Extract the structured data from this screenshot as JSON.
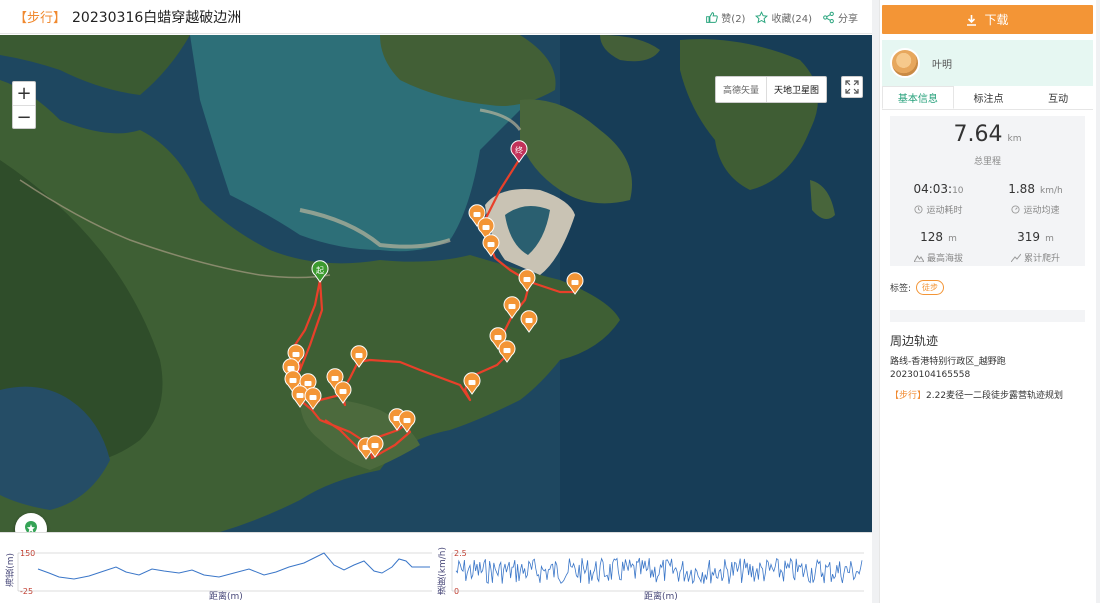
{
  "header": {
    "category": "【步行】",
    "title": "20230316白蜡穿越破边洲",
    "like": "赞(2)",
    "favorite": "收藏(24)",
    "share": "分享"
  },
  "map": {
    "zoom_in": "+",
    "zoom_out": "−",
    "layers": [
      "高德矢量",
      "天地卫星图"
    ],
    "active_layer": "天地卫星图",
    "start_label": "起",
    "end_label": "终",
    "colors": {
      "track": "#e8402a",
      "waypoint": "#f39536",
      "start": "#3c9a2e",
      "end": "#c2325a"
    }
  },
  "elevation_chart": {
    "ylabel": "海拔(m)",
    "xlabel": "距离(m)",
    "ymax": "150",
    "ymin": "-25"
  },
  "speed_chart": {
    "ylabel": "速度(km/h)",
    "xlabel": "距离(m)",
    "ymax": "2.5",
    "ymin": "0"
  },
  "sidebar": {
    "download": "下载",
    "user_name": "叶明",
    "tabs": [
      "基本信息",
      "标注点",
      "互动"
    ],
    "stats": {
      "distance": "7.64",
      "distance_unit": "km",
      "distance_label": "总里程",
      "duration_main": "04:03:",
      "duration_sec": "10",
      "duration_label": "运动耗时",
      "avg_speed": "1.88",
      "avg_speed_unit": "km/h",
      "avg_speed_label": "运动均速",
      "max_alt": "128",
      "max_alt_unit": "m",
      "max_alt_label": "最高海拔",
      "climb": "319",
      "climb_unit": "m",
      "climb_label": "累计爬升"
    },
    "tags_label": "标签:",
    "tag": "徒步",
    "nearby_title": "周边轨迹",
    "nearby_1_line1": "路线-香港特别行政区_越野跑",
    "nearby_1_line2": "20230104165558",
    "nearby_2_cat": "【步行】",
    "nearby_2_title": "2.22麦径一二段徒步露营轨迹规划"
  }
}
